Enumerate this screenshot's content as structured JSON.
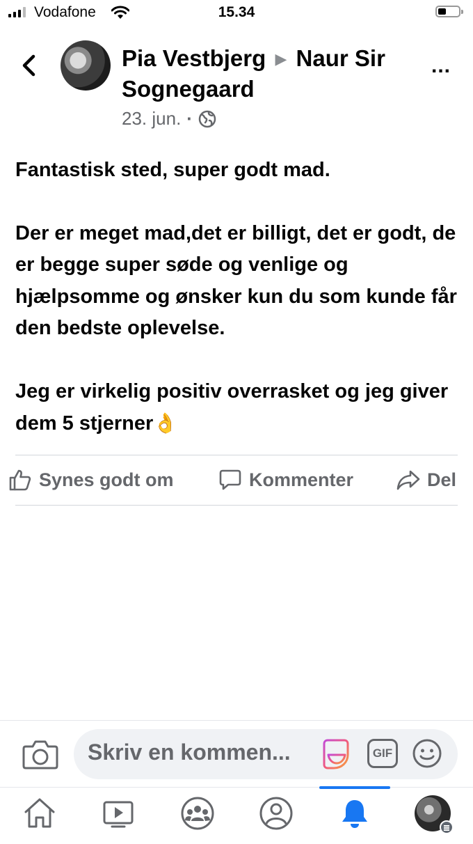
{
  "status_bar": {
    "carrier": "Vodafone",
    "time": "15.34",
    "icons": [
      "signal-icon",
      "wifi-icon",
      "battery-icon"
    ]
  },
  "header": {
    "author": "Pia Vestbjerg",
    "separator_icon": "triangle-right-icon",
    "target": "Naur Sir Sognegaard",
    "date": "23. jun.",
    "dot": "·",
    "privacy_icon": "globe-icon",
    "back_icon": "chevron-left-icon",
    "more_icon": "more-icon",
    "more_label": "..."
  },
  "post": {
    "paragraphs": [
      "Fantastisk sted, super godt mad.",
      "Der er meget mad,det er billigt, det er godt, de er begge super søde og venlige og hjælpsomme og ønsker kun du som kunde får den bedste oplevelse.",
      "Jeg er virkelig positiv overrasket og jeg giver dem 5 stjerner"
    ],
    "trailing_emoji": "👌"
  },
  "actions": {
    "like": "Synes godt om",
    "comment": "Kommenter",
    "share": "Del"
  },
  "comment_bar": {
    "placeholder": "Skriv en kommen...",
    "gif_label": "GIF",
    "icons": [
      "camera-icon",
      "sticker-icon",
      "gif-icon",
      "emoji-icon"
    ]
  },
  "tab_bar": {
    "tabs": [
      "home-icon",
      "video-icon",
      "groups-icon",
      "profile-icon",
      "notifications-icon",
      "menu-profile-icon"
    ],
    "active_index": 4,
    "accent_color": "#1877f2",
    "icon_color": "#65676b"
  }
}
